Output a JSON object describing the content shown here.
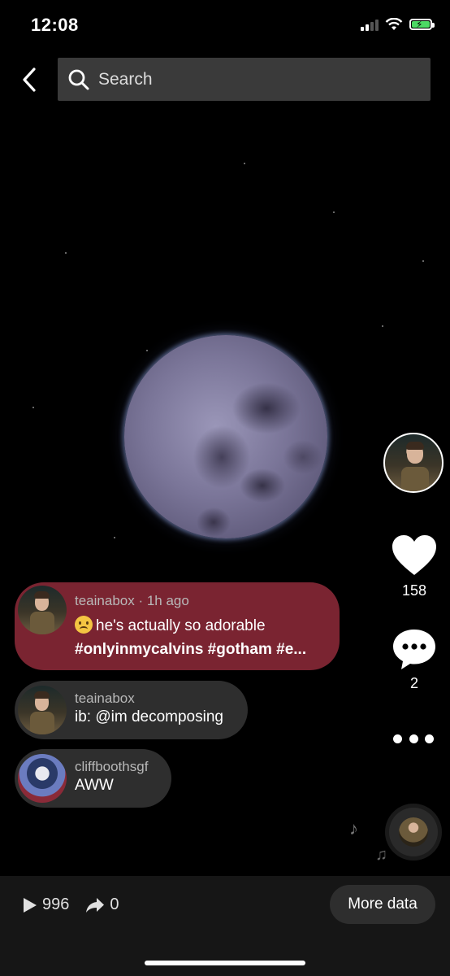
{
  "status_bar": {
    "time": "12:08"
  },
  "search": {
    "placeholder": "Search"
  },
  "stats": {
    "likes": "158",
    "comments": "2"
  },
  "comments": [
    {
      "username": "teainabox",
      "time": "1h ago",
      "meta": "teainabox · 1h ago",
      "text": "he's actually so adorable",
      "tags": "#onlyinmycalvins #gotham #e..."
    },
    {
      "username": "teainabox",
      "text": "ib: @im decomposing"
    },
    {
      "username": "cliffboothsgf",
      "text": "AWW"
    }
  ],
  "bottom_bar": {
    "plays": "996",
    "shares": "0",
    "more_data_label": "More data"
  },
  "colors": {
    "highlight_comment": "#7a2431",
    "comment_bg": "#2e2e2e",
    "background": "#000000"
  }
}
